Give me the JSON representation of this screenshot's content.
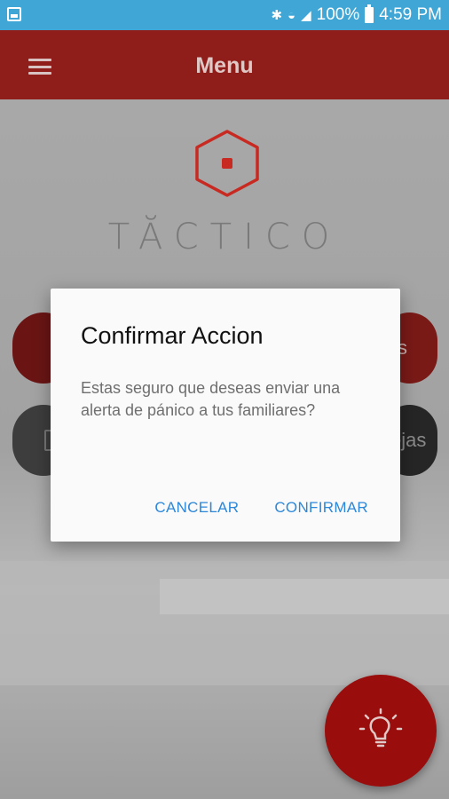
{
  "status_bar": {
    "battery": "100%",
    "time": "4:59 PM"
  },
  "app_bar": {
    "title": "Menu"
  },
  "logo": {
    "text": "TĂCTICO"
  },
  "background_buttons": {
    "right_red_partial": "s",
    "right_dark_partial": "ejas"
  },
  "dialog": {
    "title": "Confirmar Accion",
    "message": "Estas seguro que deseas enviar una alerta de pánico a tus familiares?",
    "cancel_label": "CANCELAR",
    "confirm_label": "CONFIRMAR"
  },
  "colors": {
    "status_bar": "#3fa6d6",
    "app_bar": "#8f1d1a",
    "accent_red": "#c82a22",
    "dialog_button": "#2d87d8",
    "fab": "#9a0d0d"
  }
}
